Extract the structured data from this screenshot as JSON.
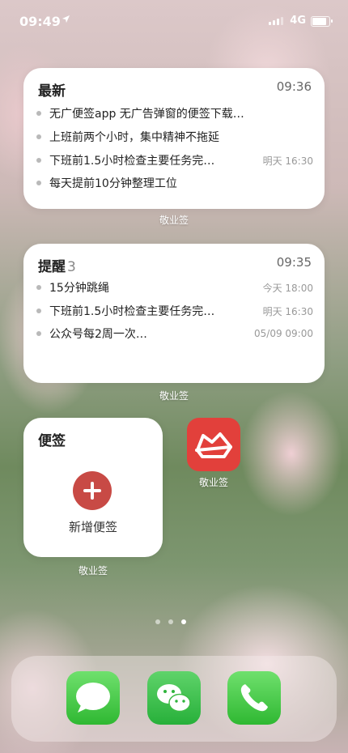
{
  "status_bar": {
    "time": "09:49",
    "network": "4G"
  },
  "widgets": {
    "latest": {
      "title": "最新",
      "time": "09:36",
      "items": [
        {
          "text": "无广便签app 无广告弹窗的便签下载…",
          "meta": ""
        },
        {
          "text": "上班前两个小时，集中精神不拖延",
          "meta": ""
        },
        {
          "text": "下班前1.5小时检查主要任务完…",
          "meta": "明天 16:30"
        },
        {
          "text": "每天提前10分钟整理工位",
          "meta": ""
        }
      ],
      "caption": "敬业签"
    },
    "reminders": {
      "title": "提醒",
      "count": "3",
      "time": "09:35",
      "items": [
        {
          "text": "15分钟跳绳",
          "meta": "今天 18:00"
        },
        {
          "text": "下班前1.5小时检查主要任务完…",
          "meta": "明天 16:30"
        },
        {
          "text": "公众号每2周一次…",
          "meta": "05/09 09:00"
        }
      ],
      "caption": "敬业签"
    },
    "notes": {
      "title": "便签",
      "add_label": "新增便签",
      "caption": "敬业签"
    }
  },
  "app": {
    "name": "敬业签",
    "icon": "jingyeqian-app-icon",
    "color": "#e2403b"
  },
  "page_indicator": {
    "count": 3,
    "active": 3
  },
  "dock": [
    {
      "name": "messages",
      "icon": "message-bubble-icon"
    },
    {
      "name": "wechat",
      "icon": "wechat-icon"
    },
    {
      "name": "phone",
      "icon": "phone-icon"
    }
  ]
}
